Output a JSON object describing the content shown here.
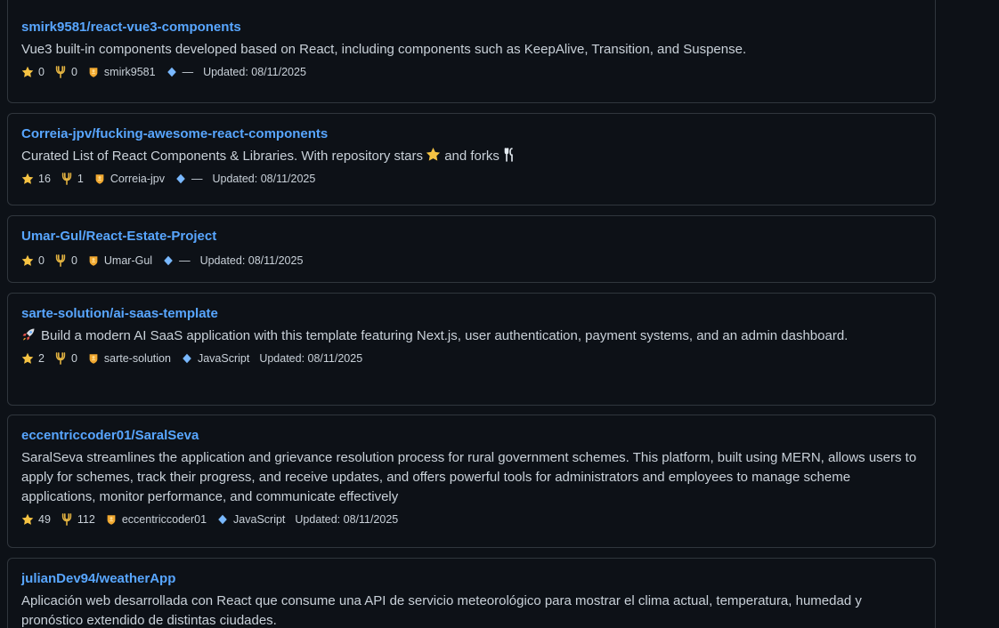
{
  "colors": {
    "background": "#0d1117",
    "card_border": "#30363d",
    "link": "#58a6ff",
    "text": "#c9d1d9",
    "star": "#f6c343",
    "fork": "#e3b341",
    "owner": "#f0a830",
    "language": "#79b8ff"
  },
  "meta_icons": {
    "stars": "star-icon",
    "forks": "fork-icon",
    "owner": "owner-badge-icon",
    "language": "diamond-icon"
  },
  "repos": [
    {
      "name": "smirk9581/react-vue3-components",
      "description": "Vue3 built-in components developed based on React, including components such as KeepAlive, Transition, and Suspense.",
      "stars": "0",
      "forks": "0",
      "owner": "smirk9581",
      "language": "—",
      "updated": "Updated: 08/11/2025"
    },
    {
      "name": "Correia-jpv/fucking-awesome-react-components",
      "description_parts": [
        "Curated List of React Components & Libraries. With repository stars",
        " and forks"
      ],
      "stars": "16",
      "forks": "1",
      "owner": "Correia-jpv",
      "language": "—",
      "updated": "Updated: 08/11/2025"
    },
    {
      "name": "Umar-Gul/React-Estate-Project",
      "stars": "0",
      "forks": "0",
      "owner": "Umar-Gul",
      "language": "—",
      "updated": "Updated: 08/11/2025"
    },
    {
      "name": "sarte-solution/ai-saas-template",
      "description": "Build a modern AI SaaS application with this template featuring Next.js, user authentication, payment systems, and an admin dashboard.",
      "stars": "2",
      "forks": "0",
      "owner": "sarte-solution",
      "language": "JavaScript",
      "updated": "Updated: 08/11/2025"
    },
    {
      "name": "eccentriccoder01/SaralSeva",
      "description": "SaralSeva streamlines the application and grievance resolution process for rural government schemes. This platform, built using MERN, allows users to apply for schemes, track their progress, and receive updates, and offers powerful tools for administrators and employees to manage scheme applications, monitor performance, and communicate effectively",
      "stars": "49",
      "forks": "112",
      "owner": "eccentriccoder01",
      "language": "JavaScript",
      "updated": "Updated: 08/11/2025"
    },
    {
      "name": "julianDev94/weatherApp",
      "description": "Aplicación web desarrollada con React que consume una API de servicio meteorológico para mostrar el clima actual, temperatura, humedad y pronóstico extendido de distintas ciudades."
    }
  ]
}
